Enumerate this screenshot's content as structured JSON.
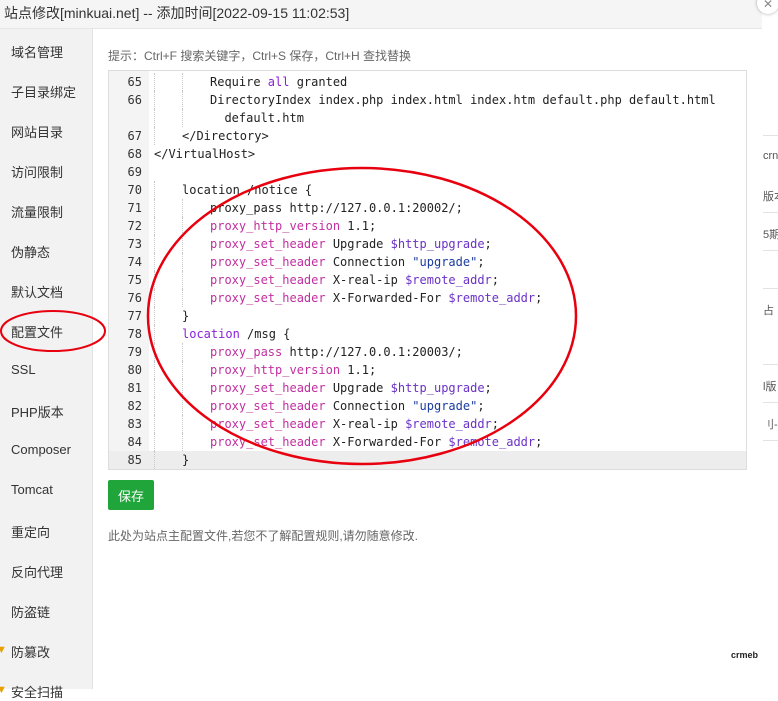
{
  "window": {
    "title": "站点修改[minkuai.net] -- 添加时间[2022-09-15 11:02:53]",
    "close_glyph": "✕"
  },
  "sidebar": {
    "items": [
      {
        "label": "域名管理"
      },
      {
        "label": "子目录绑定"
      },
      {
        "label": "网站目录"
      },
      {
        "label": "访问限制"
      },
      {
        "label": "流量限制"
      },
      {
        "label": "伪静态"
      },
      {
        "label": "默认文档"
      },
      {
        "label": "配置文件",
        "active": true
      },
      {
        "label": "SSL"
      },
      {
        "label": "PHP版本"
      },
      {
        "label": "Composer"
      },
      {
        "label": "Tomcat"
      },
      {
        "label": "重定向"
      },
      {
        "label": "反向代理"
      },
      {
        "label": "防盗链"
      },
      {
        "label": "防篡改",
        "warning": true
      },
      {
        "label": "安全扫描",
        "warning": true
      }
    ]
  },
  "main": {
    "tip": "提示：Ctrl+F 搜索关键字，Ctrl+S 保存，Ctrl+H 查找替换",
    "save_label": "保存",
    "note": "此处为站点主配置文件,若您不了解配置规则,请勿随意修改."
  },
  "editor": {
    "active_line": "85",
    "lines": [
      {
        "n": "65",
        "indent": 2,
        "tokens": [
          [
            "plain",
            "Require "
          ],
          [
            "kw",
            "all"
          ],
          [
            "plain",
            " granted"
          ]
        ]
      },
      {
        "n": "66",
        "indent": 2,
        "tokens": [
          [
            "plain",
            "DirectoryIndex index.php index.html index.htm default.php default.html"
          ]
        ]
      },
      {
        "n": "",
        "indent": 2,
        "tokens": [
          [
            "plain",
            "  default.htm"
          ]
        ]
      },
      {
        "n": "67",
        "indent": 1,
        "tokens": [
          [
            "plain",
            "</Directory>"
          ]
        ]
      },
      {
        "n": "68",
        "indent": 0,
        "tokens": [
          [
            "plain",
            "</VirtualHost>"
          ]
        ]
      },
      {
        "n": "69",
        "indent": 0,
        "tokens": []
      },
      {
        "n": "70",
        "indent": 1,
        "tokens": [
          [
            "plain",
            "location /notice {"
          ]
        ]
      },
      {
        "n": "71",
        "indent": 2,
        "tokens": [
          [
            "plain",
            "proxy_pass http://127.0.0.1:20002/;"
          ]
        ]
      },
      {
        "n": "72",
        "indent": 2,
        "tokens": [
          [
            "dir",
            "proxy_http_version"
          ],
          [
            "plain",
            " 1.1;"
          ]
        ]
      },
      {
        "n": "73",
        "indent": 2,
        "tokens": [
          [
            "dir",
            "proxy_set_header"
          ],
          [
            "plain",
            " Upgrade "
          ],
          [
            "var",
            "$http_upgrade"
          ],
          [
            "plain",
            ";"
          ]
        ]
      },
      {
        "n": "74",
        "indent": 2,
        "tokens": [
          [
            "dir",
            "proxy_set_header"
          ],
          [
            "plain",
            " Connection "
          ],
          [
            "str",
            "\"upgrade\""
          ],
          [
            "plain",
            ";"
          ]
        ]
      },
      {
        "n": "75",
        "indent": 2,
        "tokens": [
          [
            "dir",
            "proxy_set_header"
          ],
          [
            "plain",
            " X-real-ip "
          ],
          [
            "var",
            "$remote_addr"
          ],
          [
            "plain",
            ";"
          ]
        ]
      },
      {
        "n": "76",
        "indent": 2,
        "tokens": [
          [
            "dir",
            "proxy_set_header"
          ],
          [
            "plain",
            " X-Forwarded-For "
          ],
          [
            "var",
            "$remote_addr"
          ],
          [
            "plain",
            ";"
          ]
        ]
      },
      {
        "n": "77",
        "indent": 1,
        "tokens": [
          [
            "plain",
            "}"
          ]
        ]
      },
      {
        "n": "78",
        "indent": 1,
        "tokens": [
          [
            "kw",
            "location"
          ],
          [
            "plain",
            " /msg {"
          ]
        ]
      },
      {
        "n": "79",
        "indent": 2,
        "tokens": [
          [
            "dir",
            "proxy_pass"
          ],
          [
            "plain",
            " http://127.0.0.1:20003/;"
          ]
        ]
      },
      {
        "n": "80",
        "indent": 2,
        "tokens": [
          [
            "dir",
            "proxy_http_version"
          ],
          [
            "plain",
            " 1.1;"
          ]
        ]
      },
      {
        "n": "81",
        "indent": 2,
        "tokens": [
          [
            "dir",
            "proxy_set_header"
          ],
          [
            "plain",
            " Upgrade "
          ],
          [
            "var",
            "$http_upgrade"
          ],
          [
            "plain",
            ";"
          ]
        ]
      },
      {
        "n": "82",
        "indent": 2,
        "tokens": [
          [
            "dir",
            "proxy_set_header"
          ],
          [
            "plain",
            " Connection "
          ],
          [
            "str",
            "\"upgrade\""
          ],
          [
            "plain",
            ";"
          ]
        ]
      },
      {
        "n": "83",
        "indent": 2,
        "tokens": [
          [
            "dir",
            "proxy_set_header"
          ],
          [
            "plain",
            " X-real-ip "
          ],
          [
            "var",
            "$remote_addr"
          ],
          [
            "plain",
            ";"
          ]
        ]
      },
      {
        "n": "84",
        "indent": 2,
        "tokens": [
          [
            "dir",
            "proxy_set_header"
          ],
          [
            "plain",
            " X-Forwarded-For "
          ],
          [
            "var",
            "$remote_addr"
          ],
          [
            "plain",
            ";"
          ]
        ]
      },
      {
        "n": "85",
        "indent": 1,
        "tokens": [
          [
            "plain",
            "}"
          ]
        ]
      }
    ]
  },
  "background_fragments": [
    "crn",
    "版本",
    "5期",
    "占",
    "l版",
    "刂-商"
  ],
  "watermark": "crmeb",
  "annotation_color": "#e8000f",
  "colors": {
    "save_button": "#20a53a",
    "keyword": "#8d22d8",
    "directive": "#c02fa0",
    "variable": "#6a32c6",
    "string": "#1a3c9e"
  }
}
